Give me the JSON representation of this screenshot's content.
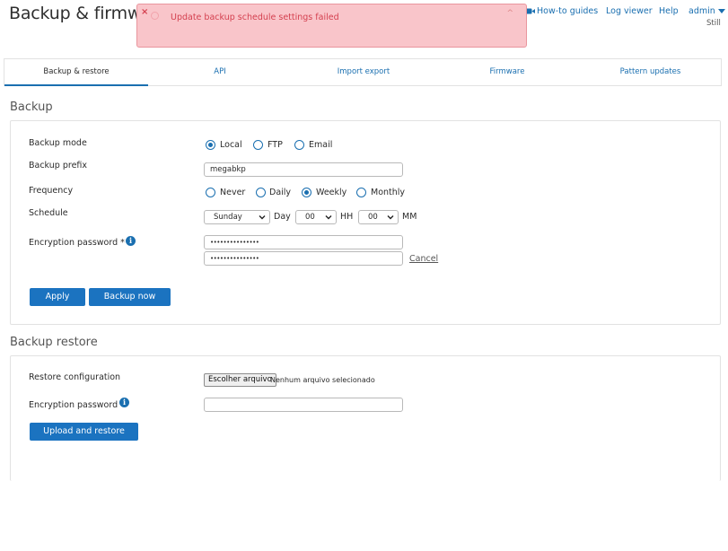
{
  "header": {
    "title": "Backup & firmwa",
    "links": {
      "howto": "How-to guides",
      "logviewer": "Log viewer",
      "help": "Help"
    },
    "user": {
      "name": "admin",
      "subtitle": "Still"
    }
  },
  "alert": {
    "message": "Update backup schedule settings failed",
    "close_glyph": "×",
    "collapse_glyph": "^"
  },
  "tabs": [
    {
      "label": "Backup & restore",
      "active": true
    },
    {
      "label": "API",
      "active": false
    },
    {
      "label": "Import export",
      "active": false
    },
    {
      "label": "Firmware",
      "active": false
    },
    {
      "label": "Pattern updates",
      "active": false
    }
  ],
  "backup": {
    "section_title": "Backup",
    "mode": {
      "label": "Backup mode",
      "options": [
        {
          "label": "Local",
          "checked": true
        },
        {
          "label": "FTP",
          "checked": false
        },
        {
          "label": "Email",
          "checked": false
        }
      ]
    },
    "prefix": {
      "label": "Backup prefix",
      "value": "megabkp"
    },
    "frequency": {
      "label": "Frequency",
      "options": [
        {
          "label": "Never",
          "checked": false
        },
        {
          "label": "Daily",
          "checked": false
        },
        {
          "label": "Weekly",
          "checked": true
        },
        {
          "label": "Monthly",
          "checked": false
        }
      ]
    },
    "schedule": {
      "label": "Schedule",
      "day_value": "Sunday",
      "day_label": "Day",
      "hour_value": "00",
      "hour_label": "HH",
      "minute_value": "00",
      "minute_label": "MM"
    },
    "encryption": {
      "label": "Encryption password *",
      "password_mask": "•••••••••••••••",
      "confirm_mask": "•••••••••••••••",
      "cancel_label": "Cancel"
    },
    "apply_label": "Apply",
    "backup_now_label": "Backup now"
  },
  "restore": {
    "section_title": "Backup restore",
    "config_label": "Restore configuration",
    "file_button_label": "Escolher arquivo",
    "file_status": "Nenhum arquivo selecionado",
    "encryption_label": "Encryption password",
    "upload_label": "Upload and restore"
  },
  "icons": {
    "info": "info-icon",
    "video": "video-icon",
    "chevron": "chevron-down-icon"
  },
  "colors": {
    "accent": "#1a6fb0",
    "button": "#1b73c0",
    "alert_bg": "#f9c5ca",
    "alert_text": "#d4404f"
  }
}
